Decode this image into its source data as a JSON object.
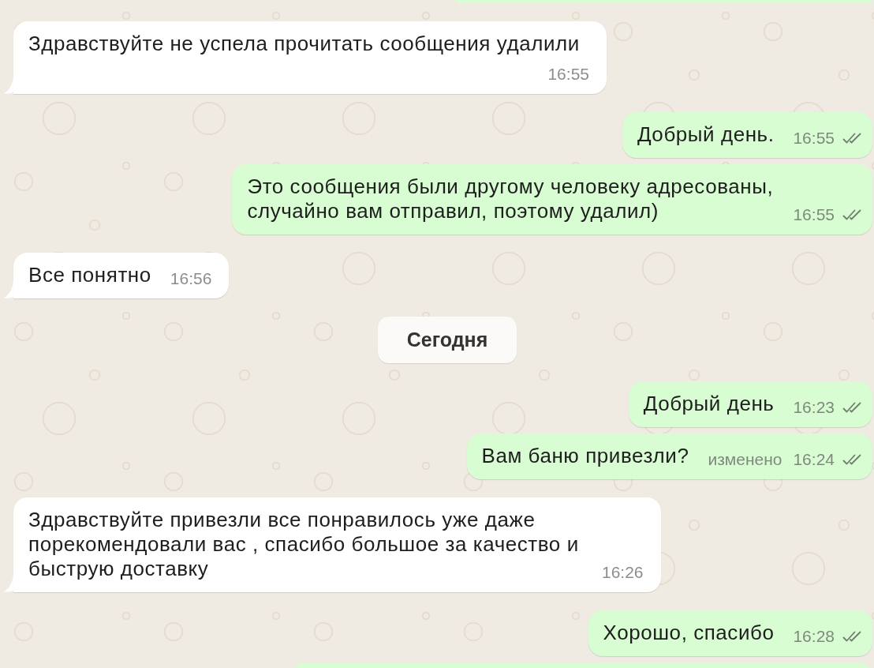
{
  "messages": [
    {
      "kind": "cut_off",
      "outgoing": true
    },
    {
      "kind": "message",
      "outgoing": false,
      "text": "Здравствуйте не успела прочитать сообщения удалили",
      "time": "16:55"
    },
    {
      "kind": "message",
      "outgoing": true,
      "text": "Добрый день.",
      "time": "16:55",
      "read": false
    },
    {
      "kind": "message",
      "outgoing": true,
      "text": "Это сообщения были другому человеку адресованы, случайно вам отправил, поэтому удалил)",
      "time": "16:55",
      "read": false
    },
    {
      "kind": "message",
      "outgoing": false,
      "text": "Все понятно",
      "time": "16:56"
    },
    {
      "kind": "date",
      "label": "Сегодня"
    },
    {
      "kind": "message",
      "outgoing": true,
      "text": "Добрый день",
      "time": "16:23",
      "read": false
    },
    {
      "kind": "message",
      "outgoing": true,
      "text": "Вам баню привезли?",
      "edited_label": "изменено",
      "time": "16:24",
      "read": false
    },
    {
      "kind": "message",
      "outgoing": false,
      "text": "Здравствуйте привезли все понравилось уже даже порекомендовали вас , спасибо большое за качество и быструю доставку",
      "time": "16:26"
    },
    {
      "kind": "message",
      "outgoing": true,
      "text": "Хорошо, спасибо",
      "time": "16:28",
      "read": false
    },
    {
      "kind": "cut_off",
      "outgoing": true
    }
  ]
}
